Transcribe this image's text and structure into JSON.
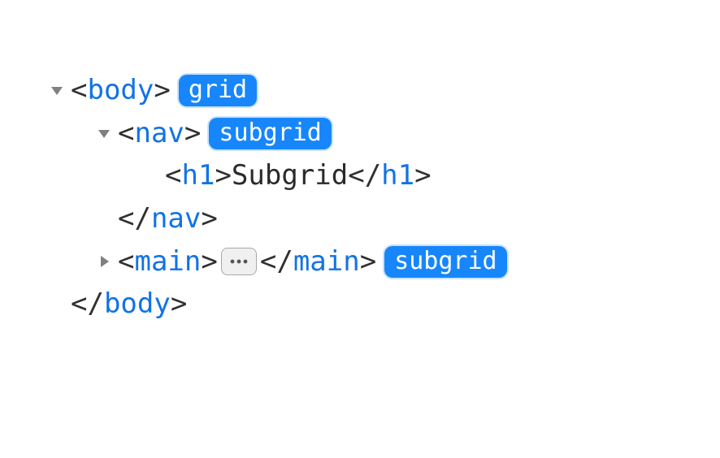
{
  "lines": {
    "body_open": {
      "tag": "body",
      "badge": "grid"
    },
    "nav_open": {
      "tag": "nav",
      "badge": "subgrid"
    },
    "h1": {
      "tag": "h1",
      "text": "Subgrid"
    },
    "nav_close": {
      "tag": "nav"
    },
    "main": {
      "tag": "main",
      "badge": "subgrid"
    },
    "body_close": {
      "tag": "body"
    }
  }
}
